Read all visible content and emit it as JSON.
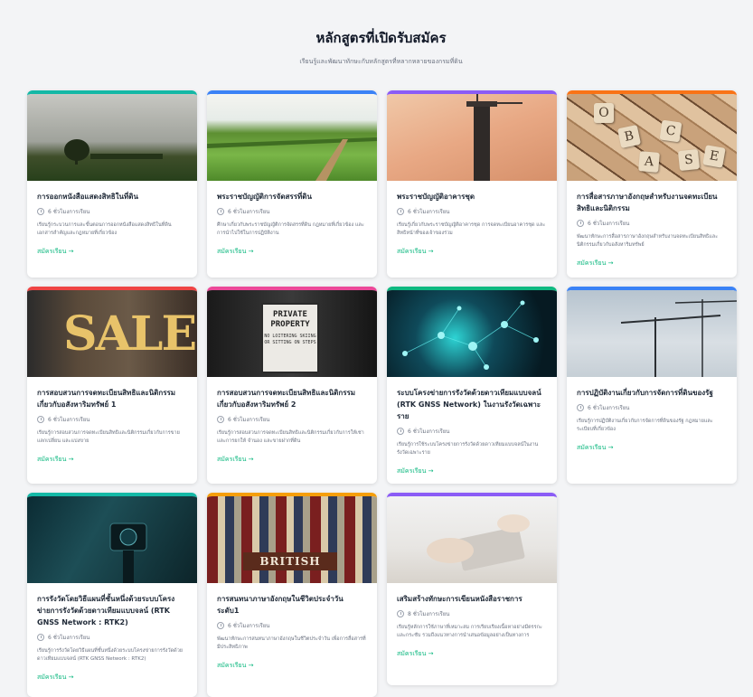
{
  "header": {
    "title": "หลักสูตรที่เปิดรับสมัคร",
    "subtitle": "เรียนรู้และพัฒนาทักษะกับหลักสูตรที่หลากหลายของกรมที่ดิน"
  },
  "colors": {
    "accent_green": "#10b981",
    "teal": "#14b8a6",
    "blue": "#3b82f6",
    "purple": "#8b5cf6",
    "orange": "#f97316",
    "red": "#ef4444",
    "pink": "#ec4899"
  },
  "courses": [
    {
      "title": "การออกหนังสือแสดงสิทธิในที่ดิน",
      "duration": "6 ชั่วโมงการเรียน",
      "description": "เรียนรู้กระบวนการและขั้นตอนการออกหนังสือแสดงสิทธิในที่ดิน เอกสารสำคัญและกฎหมายที่เกี่ยวข้อง",
      "link": "สมัครเรียน →",
      "image": "sunset-farm-photo"
    },
    {
      "title": "พระราชบัญญัติการจัดสรรที่ดิน",
      "duration": "6 ชั่วโมงการเรียน",
      "description": "ศึกษาเกี่ยวกับพระราชบัญญัติการจัดสรรที่ดิน กฎหมายที่เกี่ยวข้อง และการนำไปใช้ในการปฏิบัติงาน",
      "link": "สมัครเรียน →",
      "image": "green-field-photo"
    },
    {
      "title": "พระราชบัญญัติอาคารชุด",
      "duration": "6 ชั่วโมงการเรียน",
      "description": "เรียนรู้เกี่ยวกับพระราชบัญญัติอาคารชุด การจดทะเบียนอาคารชุด และสิทธิหน้าที่ของเจ้าของร่วม",
      "link": "สมัครเรียน →",
      "image": "construction-tower-photo"
    },
    {
      "title": "การสื่อสารภาษาอังกฤษสำหรับงานจดทะเบียนสิทธิและนิติกรรม",
      "duration": "6 ชั่วโมงการเรียน",
      "description": "พัฒนาทักษะการสื่อสารภาษาอังกฤษสำหรับงานจดทะเบียนสิทธิและนิติกรรมเกี่ยวกับอสังหาริมทรัพย์",
      "link": "สมัครเรียน →",
      "image": "letter-tiles-photo"
    },
    {
      "title": "การสอบสวนการจดทะเบียนสิทธิและนิติกรรมเกี่ยวกับอสังหาริมทรัพย์ 1",
      "duration": "6 ชั่วโมงการเรียน",
      "description": "เรียนรู้การสอบสวนการจดทะเบียนสิทธิและนิติกรรมเกี่ยวกับการขาย แลกเปลี่ยน และแบ่งขาย",
      "link": "สมัครเรียน →",
      "image": "sale-sign-photo"
    },
    {
      "title": "การสอบสวนการจดทะเบียนสิทธิและนิติกรรมเกี่ยวกับอสังหาริมทรัพย์ 2",
      "duration": "6 ชั่วโมงการเรียน",
      "description": "เรียนรู้การสอบสวนการจดทะเบียนสิทธิและนิติกรรมเกี่ยวกับการให้เช่าและการยกให้ จำนอง และขายฝากที่ดิน",
      "link": "สมัครเรียน →",
      "image": "private-property-photo"
    },
    {
      "title": "ระบบโครงข่ายการรังวัดด้วยดาวเทียมแบบจลน์ (RTK GNSS Network) ในงานรังวัดเฉพาะราย",
      "duration": "6 ชั่วโมงการเรียน",
      "description": "เรียนรู้การใช้ระบบโครงข่ายการรังวัดด้วยดาวเทียมแบบจลน์ในงานรังวัดเฉพาะราย",
      "link": "สมัครเรียน →",
      "image": "network-nodes-photo"
    },
    {
      "title": "การปฏิบัติงานเกี่ยวกับการจัดการที่ดินของรัฐ",
      "duration": "6 ชั่วโมงการเรียน",
      "description": "เรียนรู้การปฏิบัติงานเกี่ยวกับการจัดการที่ดินของรัฐ กฎหมายและระเบียบที่เกี่ยวข้อง",
      "link": "สมัครเรียน →",
      "image": "cranes-photo"
    },
    {
      "title": "การรังวัดโดยวิธีแผนที่ชั้นหนึ่งด้วยระบบโครงข่ายการรังวัดด้วยดาวเทียมแบบจลน์ (RTK GNSS Network : RTK2)",
      "duration": "6 ชั่วโมงการเรียน",
      "description": "เรียนรู้การรังวัดโดยวิธีแผนที่ชั้นหนึ่งด้วยระบบโครงข่ายการรังวัดด้วยดาวเทียมแบบจลน์ (RTK GNSS Network : RTK2)",
      "link": "สมัครเรียน →",
      "image": "survey-instrument-photo"
    },
    {
      "title": "การสนทนาภาษาอังกฤษในชีวิตประจำวัน ระดับ1",
      "duration": "6 ชั่วโมงการเรียน",
      "description": "พัฒนาทักษะการสนทนาภาษาอังกฤษในชีวิตประจำวัน เพื่อการสื่อสารที่มีประสิทธิภาพ",
      "link": "สมัครเรียน →",
      "image": "british-books-photo"
    },
    {
      "title": "เสริมสร้างทักษะการเขียนหนังสือราชการ",
      "duration": "8 ชั่วโมงการเรียน",
      "description": "เรียนรู้หลักการใช้ภาษาที่เหมาะสม การเรียบเรียงเนื้อหาอย่างมีตรรกะและกระชับ รวมถึงแนวทางการนำเสนอข้อมูลอย่างเป็นทางการ",
      "link": "สมัครเรียน →",
      "image": "typing-photo"
    }
  ],
  "image_text": {
    "sale": "SALE",
    "private_title": "PRIVATE PROPERTY",
    "private_sub": "NO LOITERING SKIING OR SITTING ON STEPS",
    "british": "BRITISH",
    "tiles": [
      "O",
      "B",
      "C",
      "S",
      "E",
      "A"
    ]
  }
}
